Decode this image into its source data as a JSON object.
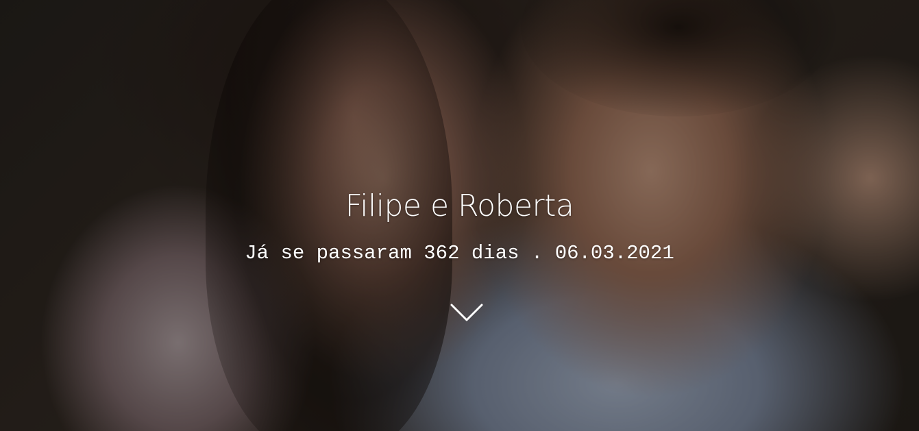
{
  "hero": {
    "title": "Filipe e Roberta",
    "subtitle": "Já se passaram 362 dias . 06.03.2021",
    "scroll_icon": "chevron-down-icon"
  },
  "colors": {
    "text": "#ffffff",
    "overlay": "rgba(0,0,0,0.38)"
  }
}
